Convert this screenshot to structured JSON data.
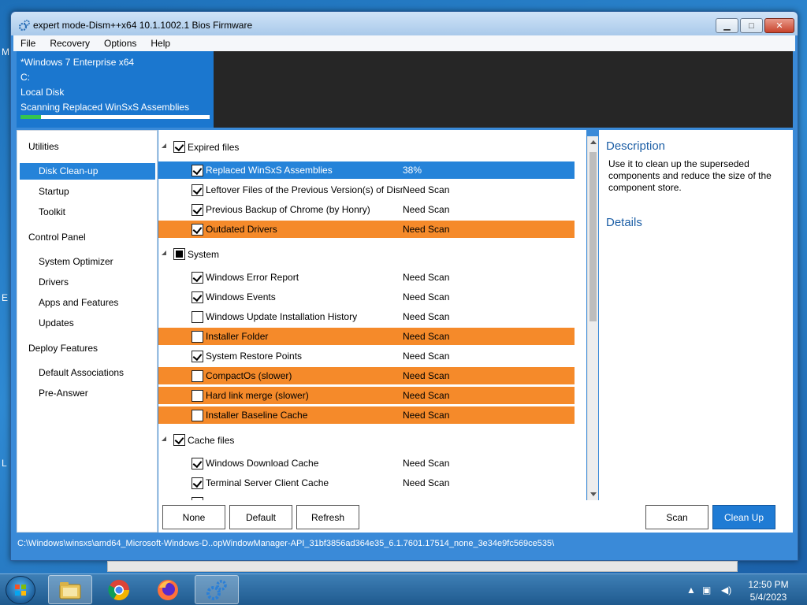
{
  "window": {
    "title": "expert mode-Dism++x64 10.1.1002.1 Bios Firmware",
    "controls": {
      "minimize": "▁",
      "maximize": "□",
      "close": "✕"
    }
  },
  "menu": [
    "File",
    "Recovery",
    "Options",
    "Help"
  ],
  "header": {
    "os": "*Windows 7 Enterprise x64",
    "drive": "C:",
    "disk": "Local Disk",
    "task": "Scanning Replaced WinSxS Assemblies",
    "progress": 0.11
  },
  "sidebar": {
    "groups": [
      {
        "label": "Utilities",
        "items": [
          "Disk Clean-up",
          "Startup",
          "Toolkit"
        ]
      },
      {
        "label": "Control Panel",
        "items": [
          "System Optimizer",
          "Drivers",
          "Apps and Features",
          "Updates"
        ]
      },
      {
        "label": "Deploy Features",
        "items": [
          "Default Associations",
          "Pre-Answer"
        ]
      }
    ],
    "active": "Disk Clean-up"
  },
  "groups": [
    {
      "label": "Expired files",
      "state": "checked"
    },
    {
      "label": "System",
      "state": "partial"
    },
    {
      "label": "Cache files",
      "state": "checked"
    }
  ],
  "items": [
    {
      "label": "Replaced WinSxS Assemblies",
      "status": "38%",
      "checked": true
    },
    {
      "label": "Leftover Files of the Previous Version(s) of Dism",
      "status": "Need Scan",
      "checked": true
    },
    {
      "label": "Previous Backup of Chrome (by Honry)",
      "status": "Need Scan",
      "checked": true
    },
    {
      "label": "Outdated Drivers",
      "status": "Need Scan",
      "checked": true
    },
    {
      "label": "Windows Error Report",
      "status": "Need Scan",
      "checked": true
    },
    {
      "label": "Windows Events",
      "status": "Need Scan",
      "checked": true
    },
    {
      "label": "Windows Update Installation History",
      "status": "Need Scan",
      "checked": false
    },
    {
      "label": "Installer Folder",
      "status": "Need Scan",
      "checked": false
    },
    {
      "label": "System Restore Points",
      "status": "Need Scan",
      "checked": true
    },
    {
      "label": "CompactOs (slower)",
      "status": "Need Scan",
      "checked": false
    },
    {
      "label": "Hard link merge (slower)",
      "status": "Need Scan",
      "checked": false
    },
    {
      "label": "Installer Baseline Cache",
      "status": "Need Scan",
      "checked": false
    },
    {
      "label": "Windows Download Cache",
      "status": "Need Scan",
      "checked": true
    },
    {
      "label": "Terminal Server Client Cache",
      "status": "Need Scan",
      "checked": true
    }
  ],
  "description": {
    "title": "Description",
    "text": "Use it to clean up the superseded components and reduce the size of the component store.",
    "details_title": "Details"
  },
  "buttons": {
    "none": "None",
    "default": "Default",
    "refresh": "Refresh",
    "scan": "Scan",
    "cleanup": "Clean Up"
  },
  "status_path": "C:\\Windows\\winsxs\\amd64_Microsoft-Windows-D..opWindowManager-API_31bf3856ad364e35_6.1.7601.17514_none_3e34e9fc569ce535\\",
  "desktop_letters": [
    "M",
    "E",
    "L"
  ],
  "taskbar": {
    "apps": [
      "file-explorer-icon",
      "chrome-icon",
      "firefox-icon",
      "dism-icon"
    ],
    "time": "12:50 PM",
    "date": "5/4/2023"
  },
  "colors": {
    "accent": "#2583d9",
    "warning": "#f58a2a",
    "header_dark": "#262626",
    "progress": "#35c54e"
  }
}
